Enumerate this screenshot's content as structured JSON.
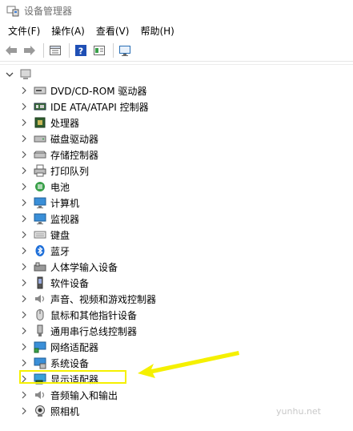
{
  "window": {
    "title": "设备管理器"
  },
  "menubar": {
    "items": [
      {
        "label": "文件(F)"
      },
      {
        "label": "操作(A)"
      },
      {
        "label": "查看(V)"
      },
      {
        "label": "帮助(H)"
      }
    ]
  },
  "toolbar": {
    "buttons": [
      "back-icon",
      "forward-icon",
      "properties-icon",
      "help-icon",
      "details-icon",
      "monitor-icon"
    ]
  },
  "tree": {
    "root_label": "",
    "categories": [
      {
        "label": "DVD/CD-ROM 驱动器",
        "icon": "dvd-icon"
      },
      {
        "label": "IDE ATA/ATAPI 控制器",
        "icon": "ide-controller-icon"
      },
      {
        "label": "处理器",
        "icon": "processor-icon"
      },
      {
        "label": "磁盘驱动器",
        "icon": "disk-drive-icon"
      },
      {
        "label": "存储控制器",
        "icon": "storage-controller-icon"
      },
      {
        "label": "打印队列",
        "icon": "printer-icon"
      },
      {
        "label": "电池",
        "icon": "battery-icon"
      },
      {
        "label": "计算机",
        "icon": "computer-icon"
      },
      {
        "label": "监视器",
        "icon": "monitor-icon"
      },
      {
        "label": "键盘",
        "icon": "keyboard-icon"
      },
      {
        "label": "蓝牙",
        "icon": "bluetooth-icon"
      },
      {
        "label": "人体学输入设备",
        "icon": "hid-icon"
      },
      {
        "label": "软件设备",
        "icon": "software-device-icon"
      },
      {
        "label": "声音、视频和游戏控制器",
        "icon": "sound-icon"
      },
      {
        "label": "鼠标和其他指针设备",
        "icon": "mouse-icon"
      },
      {
        "label": "通用串行总线控制器",
        "icon": "usb-icon"
      },
      {
        "label": "网络适配器",
        "icon": "network-adapter-icon"
      },
      {
        "label": "系统设备",
        "icon": "system-device-icon"
      },
      {
        "label": "显示适配器",
        "icon": "display-adapter-icon",
        "highlighted": true
      },
      {
        "label": "音频输入和输出",
        "icon": "audio-io-icon"
      },
      {
        "label": "照相机",
        "icon": "camera-icon"
      }
    ]
  },
  "annotation": {
    "highlight_color": "#f5f000"
  },
  "watermark": "yunhu.net"
}
